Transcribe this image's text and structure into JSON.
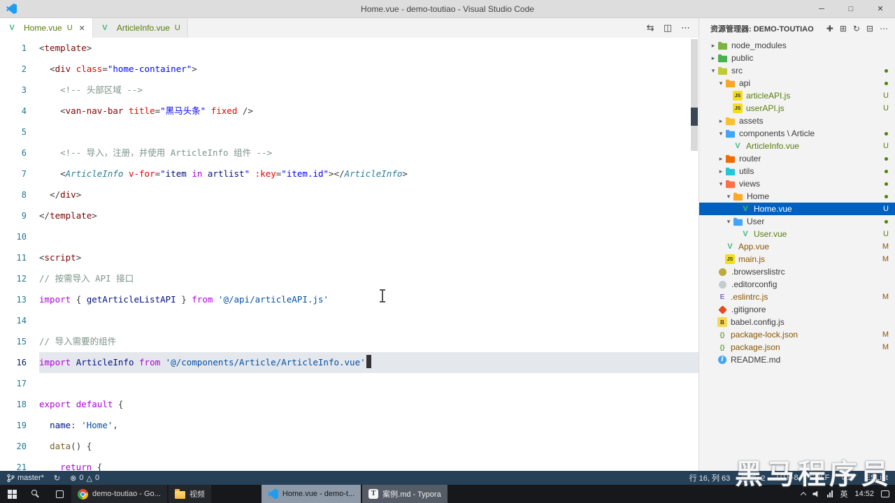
{
  "window": {
    "title": "Home.vue - demo-toutiao - Visual Studio Code"
  },
  "icons": {
    "minimize": "─",
    "maximize": "□",
    "close": "✕",
    "tab_close": "✕",
    "open_changes": "⇆",
    "split_editor": "◫",
    "more": "⋯",
    "new_file": "✚",
    "new_folder": "⊞",
    "refresh": "↻",
    "collapse_all": "⊟",
    "sync": "↻",
    "error": "⊗",
    "warning": "△",
    "chevron_down": "▾",
    "chevron_right": "▸",
    "typora": "T"
  },
  "tabs": [
    {
      "label": "Home.vue",
      "git": "U",
      "active": true
    },
    {
      "label": "ArticleInfo.vue",
      "git": "U",
      "active": false
    }
  ],
  "code": {
    "current_line": 16,
    "lines": [
      {
        "n": 1,
        "t": [
          [
            "<",
            "pu"
          ],
          [
            "template",
            "tag"
          ],
          [
            ">",
            "pu"
          ]
        ]
      },
      {
        "n": 2,
        "t": [
          [
            "  ",
            "pl"
          ],
          [
            "<",
            "pu"
          ],
          [
            "div",
            "tag"
          ],
          [
            " ",
            "pl"
          ],
          [
            "class",
            "attr"
          ],
          [
            "=",
            "pu"
          ],
          [
            "\"home-container\"",
            "aval"
          ],
          [
            ">",
            "pu"
          ]
        ]
      },
      {
        "n": 3,
        "t": [
          [
            "    ",
            "pl"
          ],
          [
            "<!-- 头部区域 -->",
            "cmt"
          ]
        ]
      },
      {
        "n": 4,
        "t": [
          [
            "    ",
            "pl"
          ],
          [
            "<",
            "pu"
          ],
          [
            "van-nav-bar",
            "tag"
          ],
          [
            " ",
            "pl"
          ],
          [
            "title",
            "attr"
          ],
          [
            "=",
            "pu"
          ],
          [
            "\"黑马头条\"",
            "aval"
          ],
          [
            " ",
            "pl"
          ],
          [
            "fixed",
            "attr"
          ],
          [
            " ",
            "pl"
          ],
          [
            "/>",
            "pu"
          ]
        ]
      },
      {
        "n": 5,
        "t": []
      },
      {
        "n": 6,
        "t": [
          [
            "    ",
            "pl"
          ],
          [
            "<!-- 导入，注册，并使用 ArticleInfo 组件 -->",
            "cmt"
          ]
        ]
      },
      {
        "n": 7,
        "t": [
          [
            "    ",
            "pl"
          ],
          [
            "<",
            "pu"
          ],
          [
            "ArticleInfo",
            "cmp"
          ],
          [
            " ",
            "pl"
          ],
          [
            "v-for",
            "attr"
          ],
          [
            "=",
            "pu"
          ],
          [
            "\"",
            "aval"
          ],
          [
            "item",
            "var"
          ],
          [
            " ",
            "pl"
          ],
          [
            "in",
            "kw"
          ],
          [
            " ",
            "pl"
          ],
          [
            "artlist",
            "var"
          ],
          [
            "\"",
            "aval"
          ],
          [
            " ",
            "pl"
          ],
          [
            ":key",
            "attr"
          ],
          [
            "=",
            "pu"
          ],
          [
            "\"item.id\"",
            "aval"
          ],
          [
            "></",
            "pu"
          ],
          [
            "ArticleInfo",
            "cmp"
          ],
          [
            ">",
            "pu"
          ]
        ]
      },
      {
        "n": 8,
        "t": [
          [
            "  ",
            "pl"
          ],
          [
            "</",
            "pu"
          ],
          [
            "div",
            "tag"
          ],
          [
            ">",
            "pu"
          ]
        ]
      },
      {
        "n": 9,
        "t": [
          [
            "</",
            "pu"
          ],
          [
            "template",
            "tag"
          ],
          [
            ">",
            "pu"
          ]
        ]
      },
      {
        "n": 10,
        "t": []
      },
      {
        "n": 11,
        "t": [
          [
            "<",
            "pu"
          ],
          [
            "script",
            "tag"
          ],
          [
            ">",
            "pu"
          ]
        ]
      },
      {
        "n": 12,
        "t": [
          [
            "// 按需导入 API 接口",
            "cmt"
          ]
        ]
      },
      {
        "n": 13,
        "t": [
          [
            "import",
            "kw"
          ],
          [
            " ",
            "pl"
          ],
          [
            "{",
            "pu"
          ],
          [
            " ",
            "pl"
          ],
          [
            "getArticleListAPI",
            "var"
          ],
          [
            " ",
            "pl"
          ],
          [
            "}",
            "pu"
          ],
          [
            " ",
            "pl"
          ],
          [
            "from",
            "kw"
          ],
          [
            " ",
            "pl"
          ],
          [
            "'@/api/articleAPI.js'",
            "str"
          ]
        ]
      },
      {
        "n": 14,
        "t": []
      },
      {
        "n": 15,
        "t": [
          [
            "// 导入需要的组件",
            "cmt"
          ]
        ]
      },
      {
        "n": 16,
        "t": [
          [
            "import",
            "kw"
          ],
          [
            " ",
            "pl"
          ],
          [
            "ArticleInfo",
            "var"
          ],
          [
            " ",
            "pl"
          ],
          [
            "from",
            "kw"
          ],
          [
            " ",
            "pl"
          ],
          [
            "'@/components/Article/ArticleInfo.vue'",
            "str"
          ]
        ]
      },
      {
        "n": 17,
        "t": []
      },
      {
        "n": 18,
        "t": [
          [
            "export",
            "kw"
          ],
          [
            " ",
            "pl"
          ],
          [
            "default",
            "kw"
          ],
          [
            " ",
            "pl"
          ],
          [
            "{",
            "pu"
          ]
        ]
      },
      {
        "n": 19,
        "t": [
          [
            "  ",
            "pl"
          ],
          [
            "name",
            "var"
          ],
          [
            ":",
            "pu"
          ],
          [
            " ",
            "pl"
          ],
          [
            "'Home'",
            "str"
          ],
          [
            ",",
            "pu"
          ]
        ]
      },
      {
        "n": 20,
        "t": [
          [
            "  ",
            "pl"
          ],
          [
            "data",
            "fn"
          ],
          [
            "() {",
            "pu"
          ]
        ]
      },
      {
        "n": 21,
        "t": [
          [
            "    ",
            "pl"
          ],
          [
            "return",
            "kw"
          ],
          [
            " ",
            "pl"
          ],
          [
            "{",
            "pu"
          ]
        ]
      }
    ]
  },
  "explorer": {
    "header": "资源管理器: DEMO-TOUTIAO",
    "items": [
      {
        "level": 0,
        "chev": "right",
        "icon": "folder-node_modules",
        "label": "node_modules",
        "badge": null,
        "selected": false
      },
      {
        "level": 0,
        "chev": "right",
        "icon": "folder-public",
        "label": "public",
        "badge": null,
        "selected": false
      },
      {
        "level": 0,
        "chev": "down",
        "icon": "folder-src",
        "label": "src",
        "badge": "dot",
        "selected": false
      },
      {
        "level": 1,
        "chev": "down",
        "icon": "folder-api",
        "label": "api",
        "badge": "dot",
        "selected": false
      },
      {
        "level": 2,
        "chev": null,
        "icon": "js",
        "label": "articleAPI.js",
        "badge": "U",
        "selected": false
      },
      {
        "level": 2,
        "chev": null,
        "icon": "js",
        "label": "userAPI.js",
        "badge": "U",
        "selected": false
      },
      {
        "level": 1,
        "chev": "right",
        "icon": "folder-assets",
        "label": "assets",
        "badge": null,
        "selected": false
      },
      {
        "level": 1,
        "chev": "down",
        "icon": "folder-components",
        "label": "components \\ Article",
        "badge": "dot",
        "selected": false
      },
      {
        "level": 2,
        "chev": null,
        "icon": "vue",
        "label": "ArticleInfo.vue",
        "badge": "U",
        "selected": false
      },
      {
        "level": 1,
        "chev": "right",
        "icon": "folder-router",
        "label": "router",
        "badge": "dot",
        "selected": false
      },
      {
        "level": 1,
        "chev": "right",
        "icon": "folder-utils",
        "label": "utils",
        "badge": "dot",
        "selected": false
      },
      {
        "level": 1,
        "chev": "down",
        "icon": "folder-views",
        "label": "views",
        "badge": "dot",
        "selected": false
      },
      {
        "level": 2,
        "chev": "down",
        "icon": "folder-home",
        "label": "Home",
        "badge": "dot",
        "selected": false
      },
      {
        "level": 3,
        "chev": null,
        "icon": "vue",
        "label": "Home.vue",
        "badge": "U",
        "selected": true
      },
      {
        "level": 2,
        "chev": "down",
        "icon": "folder-user",
        "label": "User",
        "badge": "dot",
        "selected": false
      },
      {
        "level": 3,
        "chev": null,
        "icon": "vue",
        "label": "User.vue",
        "badge": "U",
        "selected": false
      },
      {
        "level": 1,
        "chev": null,
        "icon": "vue",
        "label": "App.vue",
        "badge": "M",
        "selected": false
      },
      {
        "level": 1,
        "chev": null,
        "icon": "js",
        "label": "main.js",
        "badge": "M",
        "selected": false
      },
      {
        "level": 0,
        "chev": null,
        "icon": "browserslist",
        "label": ".browserslistrc",
        "badge": null,
        "selected": false
      },
      {
        "level": 0,
        "chev": null,
        "icon": "editorconfig",
        "label": ".editorconfig",
        "badge": null,
        "selected": false
      },
      {
        "level": 0,
        "chev": null,
        "icon": "eslint",
        "label": ".eslintrc.js",
        "badge": "M",
        "selected": false
      },
      {
        "level": 0,
        "chev": null,
        "icon": "git",
        "label": ".gitignore",
        "badge": null,
        "selected": false
      },
      {
        "level": 0,
        "chev": null,
        "icon": "babel",
        "label": "babel.config.js",
        "badge": null,
        "selected": false
      },
      {
        "level": 0,
        "chev": null,
        "icon": "json",
        "label": "package-lock.json",
        "badge": "M",
        "selected": false
      },
      {
        "level": 0,
        "chev": null,
        "icon": "json",
        "label": "package.json",
        "badge": "M",
        "selected": false
      },
      {
        "level": 0,
        "chev": null,
        "icon": "readme",
        "label": "README.md",
        "badge": null,
        "selected": false
      }
    ]
  },
  "status_bar": {
    "branch": "master*",
    "errors": "0",
    "warnings": "0",
    "line_col": "行 16, 列 63",
    "indent": "空格: 2",
    "encoding": "UTF-8",
    "eol": "CRLF",
    "language": "Vue",
    "linter": "ESLint"
  },
  "taskbar": {
    "buttons": [
      {
        "label": "demo-toutiao - Go...",
        "icon": "chrome"
      },
      {
        "label": "视频",
        "icon": "folder"
      },
      {
        "label": "Home.vue - demo-t...",
        "icon": "vscode"
      },
      {
        "label": "案例.md - Typora",
        "icon": "typora"
      }
    ],
    "tray": {
      "input": "英",
      "time": "14:52"
    }
  },
  "watermark": "黑马程序员"
}
